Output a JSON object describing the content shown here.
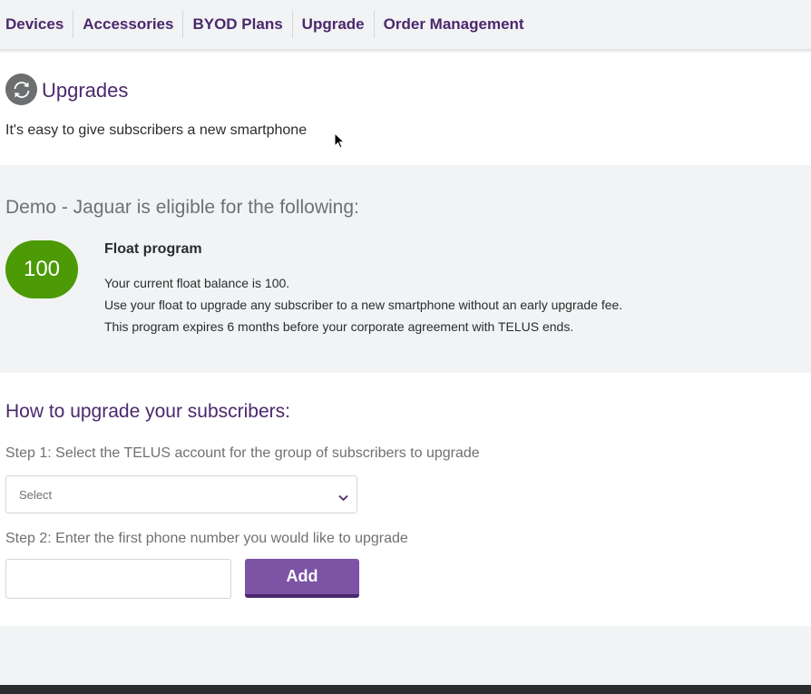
{
  "nav": {
    "items": [
      {
        "label": "Devices"
      },
      {
        "label": "Accessories"
      },
      {
        "label": "BYOD Plans"
      },
      {
        "label": "Upgrade"
      },
      {
        "label": "Order Management"
      }
    ]
  },
  "header": {
    "icon": "upgrade-cycle-icon",
    "title": "Upgrades",
    "subtitle": "It's easy to give subscribers a new smartphone"
  },
  "eligibility": {
    "title": "Demo - Jaguar is eligible for the following:",
    "badge_value": "100",
    "badge_color": "#4b9a06",
    "program": {
      "title": "Float program",
      "lines": [
        "Your current float balance is 100.",
        "Use your float to upgrade any subscriber to a new smartphone without an early upgrade fee.",
        "This program expires 6 months before your corporate agreement with TELUS ends."
      ]
    }
  },
  "howto": {
    "title": "How to upgrade your subscribers:",
    "step1_label": "Step 1: Select the TELUS account for the group of subscribers to upgrade",
    "select_value": "Select",
    "step2_label": "Step 2: Enter the first phone number you would like to upgrade",
    "phone_input_value": "",
    "add_button_label": "Add"
  },
  "colors": {
    "brand_purple": "#4b286d",
    "button_purple": "#7c53a5",
    "accent_green": "#4b9a06"
  }
}
